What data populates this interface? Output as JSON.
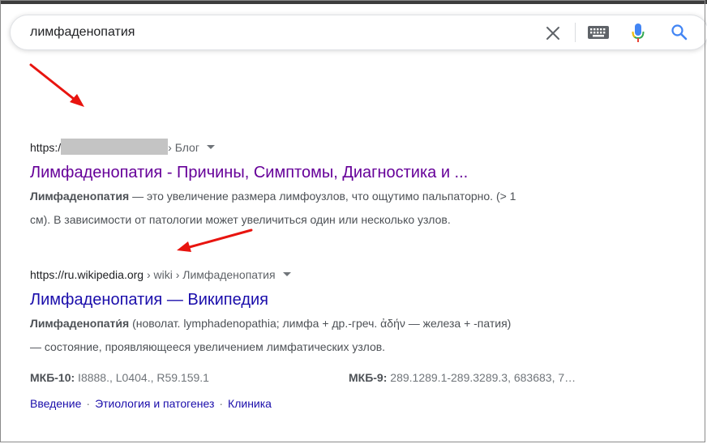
{
  "search": {
    "query": "лимфаденопатия"
  },
  "icons": {
    "clear": "close-icon",
    "keyboard": "keyboard-icon",
    "mic": "microphone-icon",
    "search": "search-icon"
  },
  "colors": {
    "link": "#1a0dab",
    "visited": "#660099",
    "arrow": "#e8140f",
    "mic_blue": "#4285f4",
    "mic_red": "#ea4335",
    "mic_yellow": "#fbbc05",
    "mic_green": "#34a853"
  },
  "results": [
    {
      "url_prefix": "https:/",
      "url_path": "› Блог",
      "title": "Лимфаденопатия - Причины, Симптомы, Диагностика и ...",
      "snippet_bold": "Лимфаденопатия",
      "snippet_line1_rest": " — это увеличение размера лимфоузлов, что ощутимо пальпаторно. (> 1",
      "snippet_line2": "см). В зависимости от патологии может увеличиться один или несколько узлов."
    },
    {
      "url_prefix": "https://ru.wikipedia.org",
      "url_path": " › wiki › Лимфаденопатия",
      "title": "Лимфаденопатия — Википедия",
      "snippet_bold": "Лимфаденопати́я",
      "snippet_line1_rest": " (новолат. lymphadenopathia; лимфа + др.-греч. ἀδήν — железа + -патия)",
      "snippet_line2": "— состояние, проявляющееся увеличением лимфатических узлов.",
      "mkb10_label": "МКБ-10:",
      "mkb10_value": " I8888., L0404., R59.159.1",
      "mkb9_label": "МКБ-9:",
      "mkb9_value": " 289.1289.1-289.3289.3, 683683, 7…",
      "sitelinks": [
        "Введение",
        "Этиология и патогенез",
        "Клиника"
      ],
      "sitelink_separator": "·"
    }
  ]
}
